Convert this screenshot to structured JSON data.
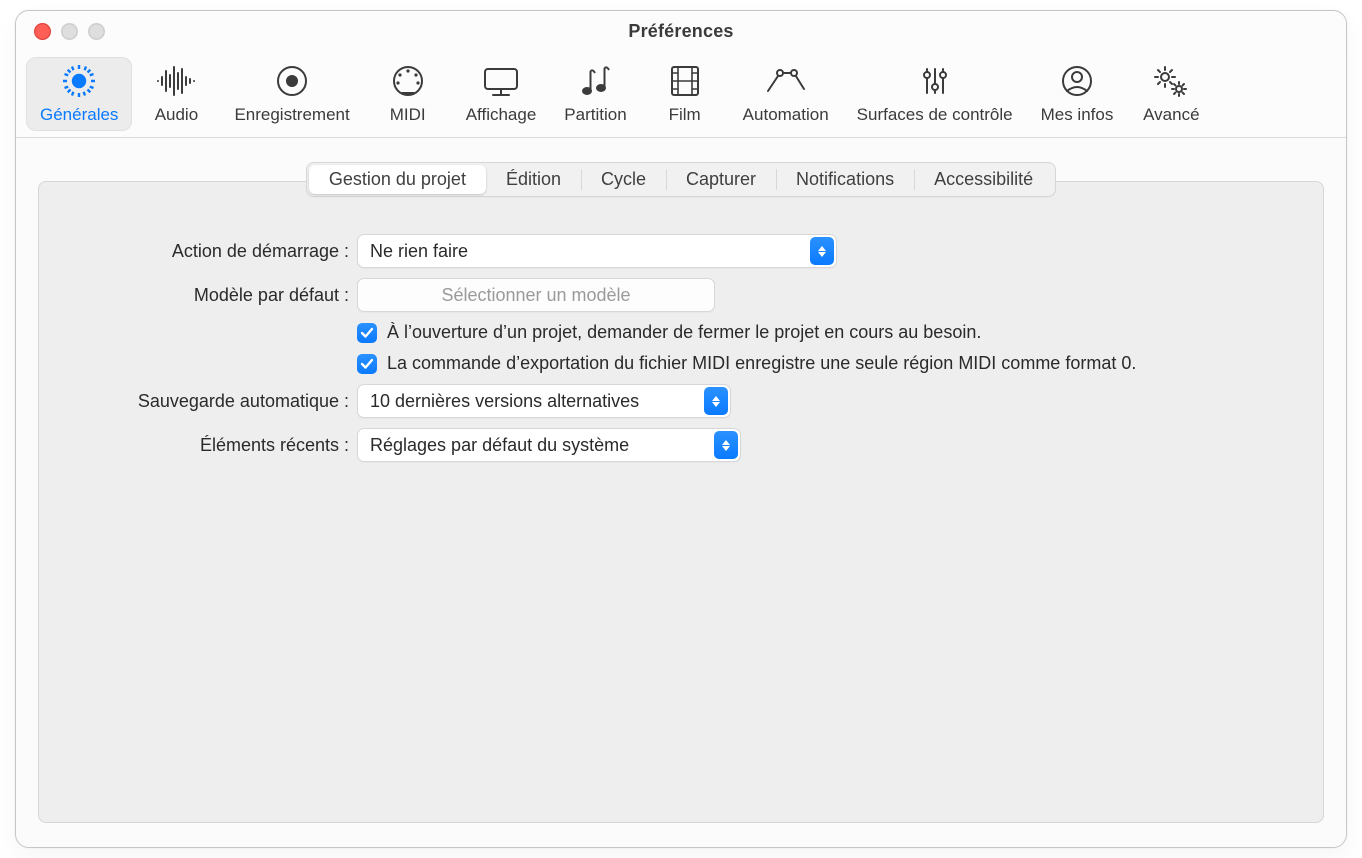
{
  "window": {
    "title": "Préférences"
  },
  "toolbar": {
    "items": [
      {
        "id": "generales",
        "label": "Générales"
      },
      {
        "id": "audio",
        "label": "Audio"
      },
      {
        "id": "enregistrement",
        "label": "Enregistrement"
      },
      {
        "id": "midi",
        "label": "MIDI"
      },
      {
        "id": "affichage",
        "label": "Affichage"
      },
      {
        "id": "partition",
        "label": "Partition"
      },
      {
        "id": "film",
        "label": "Film"
      },
      {
        "id": "automation",
        "label": "Automation"
      },
      {
        "id": "surfaces",
        "label": "Surfaces de contrôle"
      },
      {
        "id": "mesinfos",
        "label": "Mes infos"
      },
      {
        "id": "avance",
        "label": "Avancé"
      }
    ],
    "activeIndex": 0
  },
  "subtabs": {
    "items": [
      "Gestion du projet",
      "Édition",
      "Cycle",
      "Capturer",
      "Notifications",
      "Accessibilité"
    ],
    "activeIndex": 0
  },
  "form": {
    "startup_label": "Action de démarrage :",
    "startup_value": "Ne rien faire",
    "template_label": "Modèle par défaut :",
    "template_button": "Sélectionner un modèle",
    "check1_label": "À l’ouverture d’un projet, demander de fermer le projet en cours au besoin.",
    "check1_checked": true,
    "check2_label": "La commande d’exportation du fichier MIDI enregistre une seule région MIDI comme format 0.",
    "check2_checked": true,
    "autobackup_label": "Sauvegarde automatique :",
    "autobackup_value": "10 dernières versions alternatives",
    "recent_label": "Éléments récents :",
    "recent_value": "Réglages par défaut du système"
  }
}
